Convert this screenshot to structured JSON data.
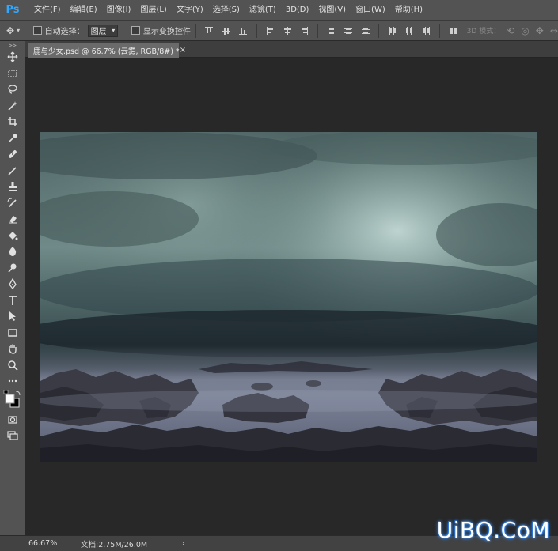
{
  "app": {
    "logo": "Ps"
  },
  "menu": [
    "文件(F)",
    "编辑(E)",
    "图像(I)",
    "图层(L)",
    "文字(Y)",
    "选择(S)",
    "滤镜(T)",
    "3D(D)",
    "视图(V)",
    "窗口(W)",
    "帮助(H)"
  ],
  "options": {
    "auto_select_label": "自动选择：",
    "auto_select_value": "图层",
    "show_transform_label": "显示变换控件",
    "mode_label": "3D 模式："
  },
  "document": {
    "tab_label": "鹿与少女.psd @ 66.7% (云雾, RGB/8#) *",
    "close_glyph": "×"
  },
  "status": {
    "zoom": "66.67%",
    "doc_size": "文档:2.75M/26.0M",
    "arrow": "›"
  },
  "watermark": "UiBQ.CoM",
  "colors": {
    "ui_panel": "#535353",
    "canvas_bg": "#282828",
    "accent": "#31a8ff"
  },
  "icons": {
    "tools": [
      "move-icon",
      "marquee-icon",
      "lasso-icon",
      "magic-wand-icon",
      "crop-icon",
      "eyedropper-icon",
      "healing-brush-icon",
      "brush-icon",
      "clone-stamp-icon",
      "history-brush-icon",
      "eraser-icon",
      "paint-bucket-icon",
      "blur-icon",
      "dodge-icon",
      "pen-icon",
      "type-icon",
      "path-select-icon",
      "rectangle-icon",
      "hand-icon",
      "zoom-icon",
      "more-tools-icon"
    ]
  }
}
